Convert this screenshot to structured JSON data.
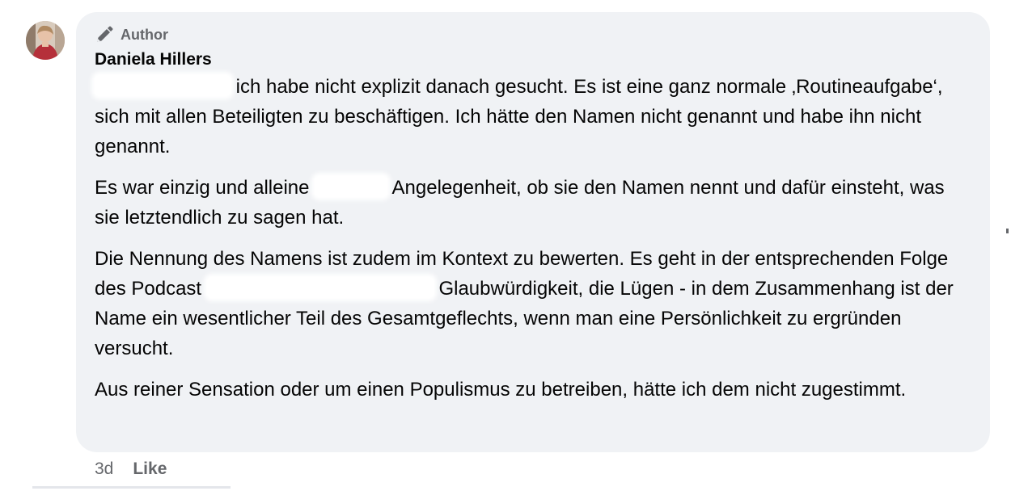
{
  "comment": {
    "avatar_icon": "user-avatar-photo",
    "badge": {
      "icon": "pen-icon",
      "label": "Author"
    },
    "author_name": "Daniela Hillers",
    "paragraphs": [
      {
        "before": "",
        "after": "ich habe nicht explizit danach gesucht. Es ist eine ganz normale ‚Routineaufgabe‘, sich mit allen Beteiligten zu beschäftigen. Ich hätte den Namen nicht genannt und habe ihn nicht genannt."
      },
      {
        "before": "Es war einzig und alleine",
        "after": "Angelegenheit, ob sie den Namen nennt und dafür einsteht, was sie letztendlich zu sagen hat."
      },
      {
        "before": "Die Nennung des Namens ist zudem im Kontext zu bewerten. Es geht in der entsprechenden Folge des Podcast",
        "after": "Glaubwürdigkeit, die Lügen - in dem Zusammenhang ist der Name ein wesentlicher Teil des Gesamtgeflechts, wenn man eine Persönlichkeit zu ergründen versucht."
      },
      {
        "text": "Aus reiner Sensation oder um einen Populismus zu betreiben, hätte ich dem nicht zugestimmt."
      }
    ],
    "timestamp": "3d",
    "like_label": "Like"
  },
  "colors": {
    "bubble_bg": "#f0f2f5",
    "secondary_text": "#65676b",
    "primary_text": "#050505"
  }
}
